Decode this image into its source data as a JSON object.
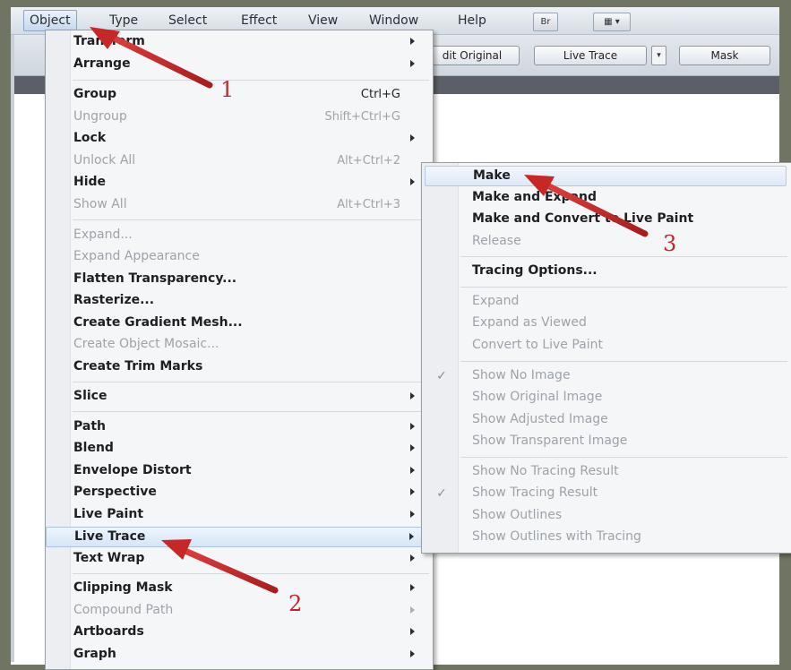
{
  "colors": {
    "arrow": "#c62828",
    "highlight": "#d6e5f7",
    "disabled_text": "#9da3aa"
  },
  "menubar": {
    "items": [
      {
        "label": "Object",
        "active": true
      },
      {
        "label": "Type"
      },
      {
        "label": "Select"
      },
      {
        "label": "Effect"
      },
      {
        "label": "View"
      },
      {
        "label": "Window"
      },
      {
        "label": "Help"
      }
    ],
    "br_button": "Br",
    "workspace_icon": "workspace-grid-icon"
  },
  "control_bar": {
    "edit_original": "dit Original",
    "live_trace": "Live Trace",
    "mask": "Mask"
  },
  "object_menu": {
    "items": [
      {
        "label": "Transform",
        "submenu": true
      },
      {
        "label": "Arrange",
        "submenu": true
      },
      {
        "label": "Group",
        "shortcut": "Ctrl+G"
      },
      {
        "label": "Ungroup",
        "shortcut": "Shift+Ctrl+G",
        "disabled": true
      },
      {
        "label": "Lock",
        "submenu": true
      },
      {
        "label": "Unlock All",
        "shortcut": "Alt+Ctrl+2",
        "disabled": true
      },
      {
        "label": "Hide",
        "submenu": true
      },
      {
        "label": "Show All",
        "shortcut": "Alt+Ctrl+3",
        "disabled": true
      },
      {
        "label": "Expand...",
        "disabled": true
      },
      {
        "label": "Expand Appearance",
        "disabled": true
      },
      {
        "label": "Flatten Transparency..."
      },
      {
        "label": "Rasterize..."
      },
      {
        "label": "Create Gradient Mesh..."
      },
      {
        "label": "Create Object Mosaic...",
        "disabled": true
      },
      {
        "label": "Create Trim Marks"
      },
      {
        "label": "Slice",
        "submenu": true
      },
      {
        "label": "Path",
        "submenu": true
      },
      {
        "label": "Blend",
        "submenu": true
      },
      {
        "label": "Envelope Distort",
        "submenu": true
      },
      {
        "label": "Perspective",
        "submenu": true
      },
      {
        "label": "Live Paint",
        "submenu": true
      },
      {
        "label": "Live Trace",
        "submenu": true,
        "highlighted": true
      },
      {
        "label": "Text Wrap",
        "submenu": true
      },
      {
        "label": "Clipping Mask",
        "submenu": true
      },
      {
        "label": "Compound Path",
        "submenu": true,
        "disabled": true
      },
      {
        "label": "Artboards",
        "submenu": true
      },
      {
        "label": "Graph",
        "submenu": true
      }
    ]
  },
  "live_trace_submenu": {
    "items": [
      {
        "label": "Make",
        "highlighted": true
      },
      {
        "label": "Make and Expand"
      },
      {
        "label": "Make and Convert to Live Paint"
      },
      {
        "label": "Release",
        "disabled": true
      },
      {
        "label": "Tracing Options..."
      },
      {
        "label": "Expand",
        "disabled": true
      },
      {
        "label": "Expand as Viewed",
        "disabled": true
      },
      {
        "label": "Convert to Live Paint",
        "disabled": true
      },
      {
        "label": "Show No Image",
        "disabled": true,
        "checked": true
      },
      {
        "label": "Show Original Image",
        "disabled": true
      },
      {
        "label": "Show Adjusted Image",
        "disabled": true
      },
      {
        "label": "Show Transparent Image",
        "disabled": true
      },
      {
        "label": "Show No Tracing Result",
        "disabled": true
      },
      {
        "label": "Show Tracing Result",
        "disabled": true,
        "checked": true
      },
      {
        "label": "Show Outlines",
        "disabled": true
      },
      {
        "label": "Show Outlines with Tracing",
        "disabled": true
      }
    ]
  },
  "callouts": {
    "one": "1",
    "two": "2",
    "three": "3"
  }
}
